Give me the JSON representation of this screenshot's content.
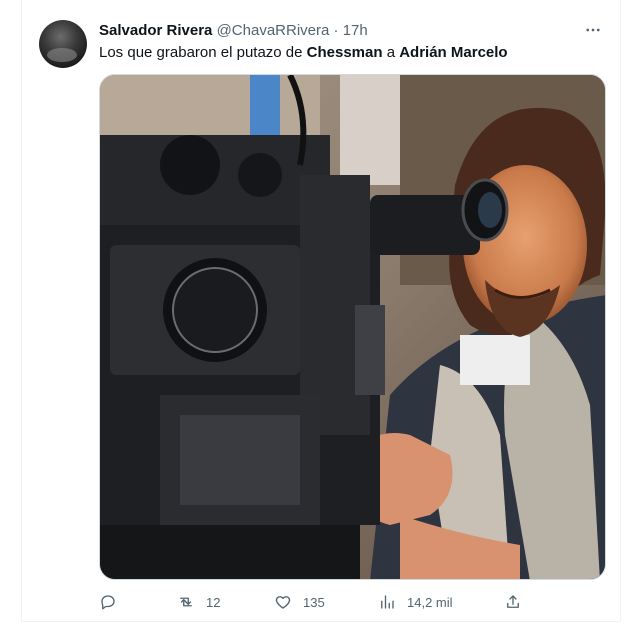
{
  "tweet": {
    "author_name": "Salvador Rivera",
    "handle": "@ChavaRRivera",
    "separator": "·",
    "time": "17h",
    "text_parts": [
      "Los que grabaron el putazo de ",
      "Chessman",
      " a ",
      "Adrián Marcelo"
    ],
    "more_icon": "more-horizontal-icon"
  },
  "media": {
    "icon": "photo"
  },
  "actions": {
    "reply": {
      "icon": "reply-icon",
      "count": ""
    },
    "retweet": {
      "icon": "retweet-icon",
      "count": "12"
    },
    "like": {
      "icon": "heart-icon",
      "count": "135"
    },
    "views": {
      "icon": "views-icon",
      "count": "14,2 mil"
    },
    "share": {
      "icon": "share-icon",
      "count": ""
    }
  },
  "colors": {
    "text": "#0f1419",
    "muted": "#536471",
    "border": "#cfd9de"
  }
}
